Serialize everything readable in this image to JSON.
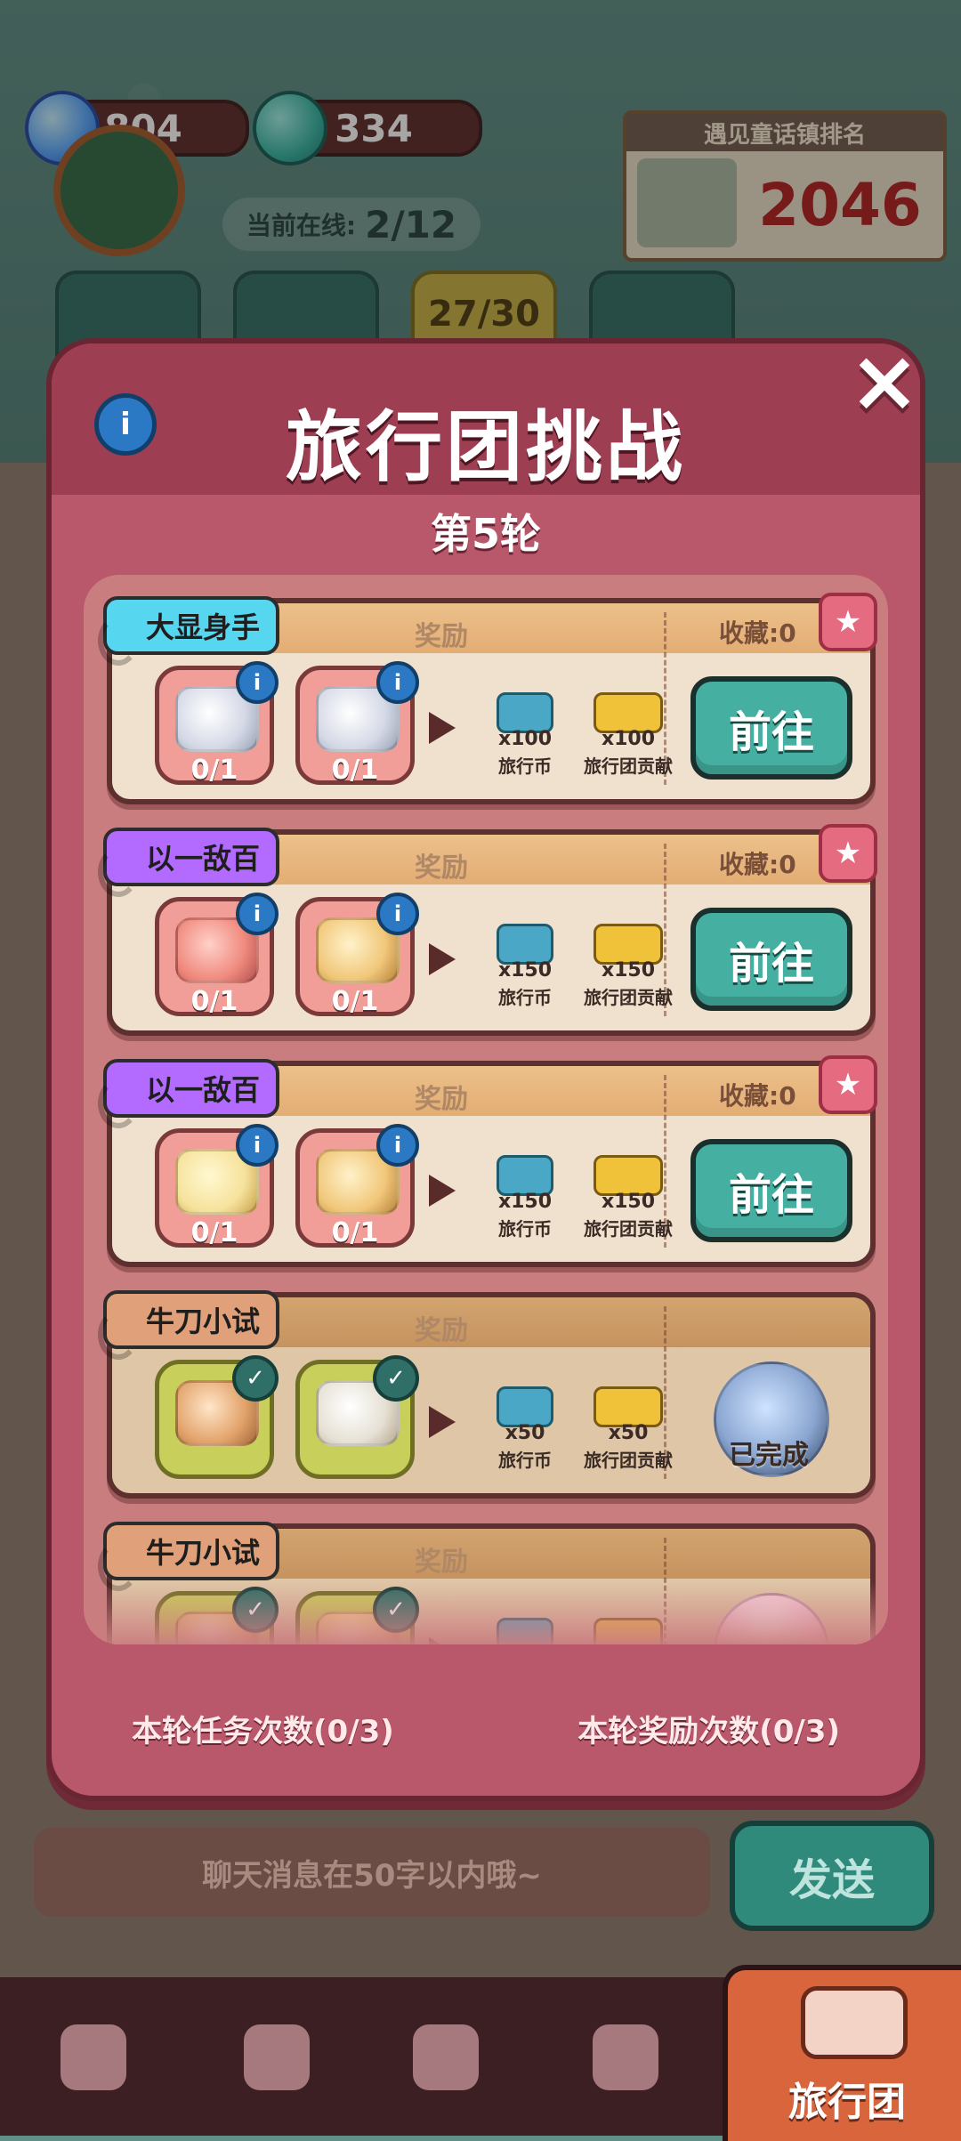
{
  "top": {
    "gems": "804",
    "travel_coins": "334",
    "online_label": "当前在线:",
    "online_value": "2/12",
    "rank_title": "遇见童话镇排名",
    "rank_value": "2046",
    "tab_counter": "27/30"
  },
  "modal": {
    "title": "旅行团挑战",
    "round": "第5轮",
    "reward_label": "奖励",
    "cards": [
      {
        "tag": "大显身手",
        "tag_color": "#57d6f0",
        "collect": "收藏:0",
        "items": [
          {
            "name": "noodle-bowl",
            "qty": "0/1"
          },
          {
            "name": "egg-rice-bowl",
            "qty": "0/1"
          }
        ],
        "rewards": [
          {
            "mult": "x100",
            "label": "旅行币"
          },
          {
            "mult": "x100",
            "label": "旅行团贡献"
          }
        ],
        "action": "前往"
      },
      {
        "tag": "以一敌百",
        "tag_color": "#b36bff",
        "collect": "收藏:0",
        "items": [
          {
            "name": "meat-slice",
            "qty": "0/1"
          },
          {
            "name": "paper-bag",
            "qty": "0/1"
          }
        ],
        "rewards": [
          {
            "mult": "x150",
            "label": "旅行币"
          },
          {
            "mult": "x150",
            "label": "旅行团贡献"
          }
        ],
        "action": "前往"
      },
      {
        "tag": "以一敌百",
        "tag_color": "#b36bff",
        "collect": "收藏:0",
        "items": [
          {
            "name": "butter",
            "qty": "0/1"
          },
          {
            "name": "paper-bag",
            "qty": "0/1"
          }
        ],
        "rewards": [
          {
            "mult": "x150",
            "label": "旅行币"
          },
          {
            "mult": "x150",
            "label": "旅行团贡献"
          }
        ],
        "action": "前往"
      },
      {
        "tag": "牛刀小试",
        "tag_color": "#e0a17a",
        "completed": true,
        "items": [
          {
            "name": "roast-chicken"
          },
          {
            "name": "rice-board"
          }
        ],
        "rewards": [
          {
            "mult": "x50",
            "label": "旅行币"
          },
          {
            "mult": "x50",
            "label": "旅行团贡献"
          }
        ],
        "status": "已完成"
      },
      {
        "tag": "牛刀小试",
        "tag_color": "#e0a17a",
        "completed": true,
        "items": [
          {
            "name": "bottle"
          },
          {
            "name": "paper-bag"
          }
        ]
      }
    ],
    "task_count": "本轮任务次数(0/3)",
    "reward_count": "本轮奖励次数(0/3)"
  },
  "chat": {
    "placeholder": "聊天消息在50字以内哦~",
    "send_label": "发送"
  },
  "bottom_nav": {
    "active_label": "旅行团"
  },
  "icons": {
    "gem": "gem-icon",
    "travel_coin": "bus-coin-icon",
    "info": "info-icon",
    "close": "close-icon",
    "star": "star-icon",
    "check": "check-icon"
  },
  "colors": {
    "modal_fill": "#b9586a",
    "modal_header": "#9e3e52",
    "go_button": "#45b0a2",
    "nav_active": "#d8653b"
  }
}
